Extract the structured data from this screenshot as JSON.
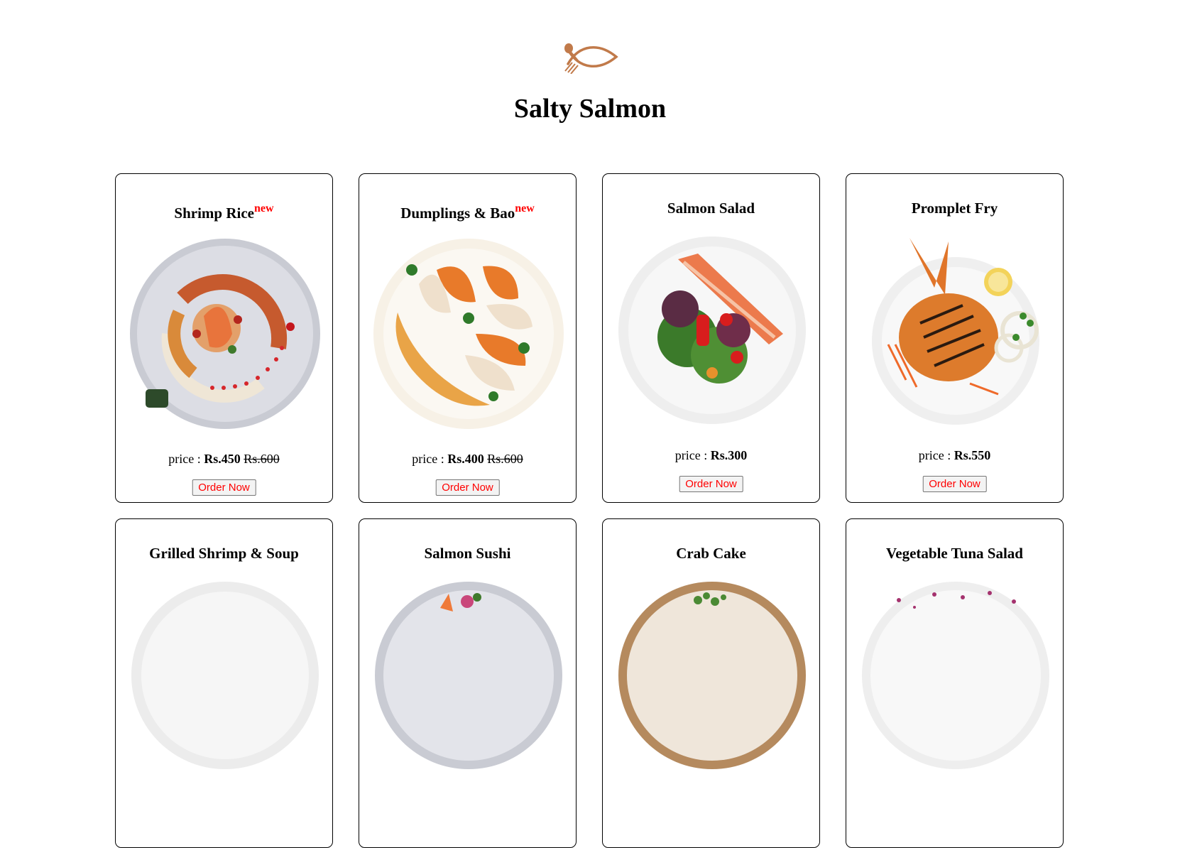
{
  "site": {
    "title": "Salty Salmon",
    "logo_icon": "fish-fork-spoon-icon",
    "brand_color": "#c17a4a"
  },
  "accent_colors": {
    "new_badge": "#ff0000",
    "order_button_text": "#ff0000"
  },
  "menu": [
    {
      "name": "Shrimp Rice",
      "badge": "new",
      "price_label": "price :",
      "price": "Rs.450",
      "old_price": "Rs.600",
      "button": "Order Now",
      "image": "shrimp-rice-plate"
    },
    {
      "name": "Dumplings & Bao",
      "badge": "new",
      "price_label": "price :",
      "price": "Rs.400",
      "old_price": "Rs.600",
      "button": "Order Now",
      "image": "dumplings-plate"
    },
    {
      "name": "Salmon Salad",
      "badge": "",
      "price_label": "price :",
      "price": "Rs.300",
      "old_price": "",
      "button": "Order Now",
      "image": "salmon-salad-plate"
    },
    {
      "name": "Promplet Fry",
      "badge": "",
      "price_label": "price :",
      "price": "Rs.550",
      "old_price": "",
      "button": "Order Now",
      "image": "pomfret-fry-plate"
    },
    {
      "name": "Grilled Shrimp & Soup",
      "badge": "",
      "image": "grilled-shrimp-soup-plate"
    },
    {
      "name": "Salmon Sushi",
      "badge": "",
      "image": "salmon-sushi-plate"
    },
    {
      "name": "Crab Cake",
      "badge": "",
      "image": "crab-cake-plate"
    },
    {
      "name": "Vegetable Tuna Salad",
      "badge": "",
      "image": "vegetable-tuna-salad-plate"
    }
  ]
}
